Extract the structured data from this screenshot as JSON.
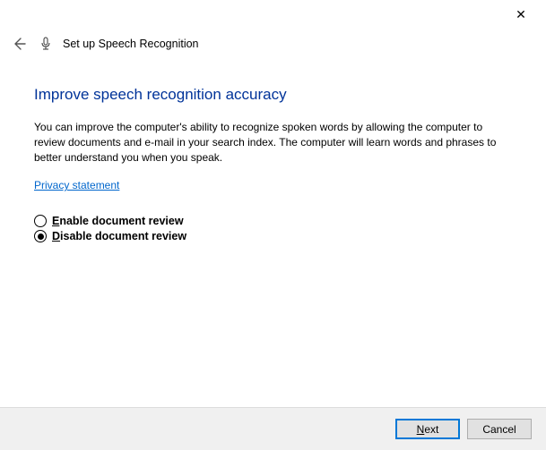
{
  "titlebar": {
    "close_icon": "✕"
  },
  "header": {
    "title": "Set up Speech Recognition"
  },
  "main": {
    "heading": "Improve speech recognition accuracy",
    "description": "You can improve the computer's ability to recognize spoken words by allowing the computer to review documents and e-mail in your search index. The computer will learn words and phrases to better understand you when you speak.",
    "privacy_link": "Privacy statement",
    "options": {
      "enable": {
        "prefix": "E",
        "rest": "nable document review",
        "selected": false
      },
      "disable": {
        "prefix": "D",
        "rest": "isable document review",
        "selected": true
      }
    }
  },
  "footer": {
    "next": {
      "prefix": "N",
      "rest": "ext"
    },
    "cancel": "Cancel"
  }
}
